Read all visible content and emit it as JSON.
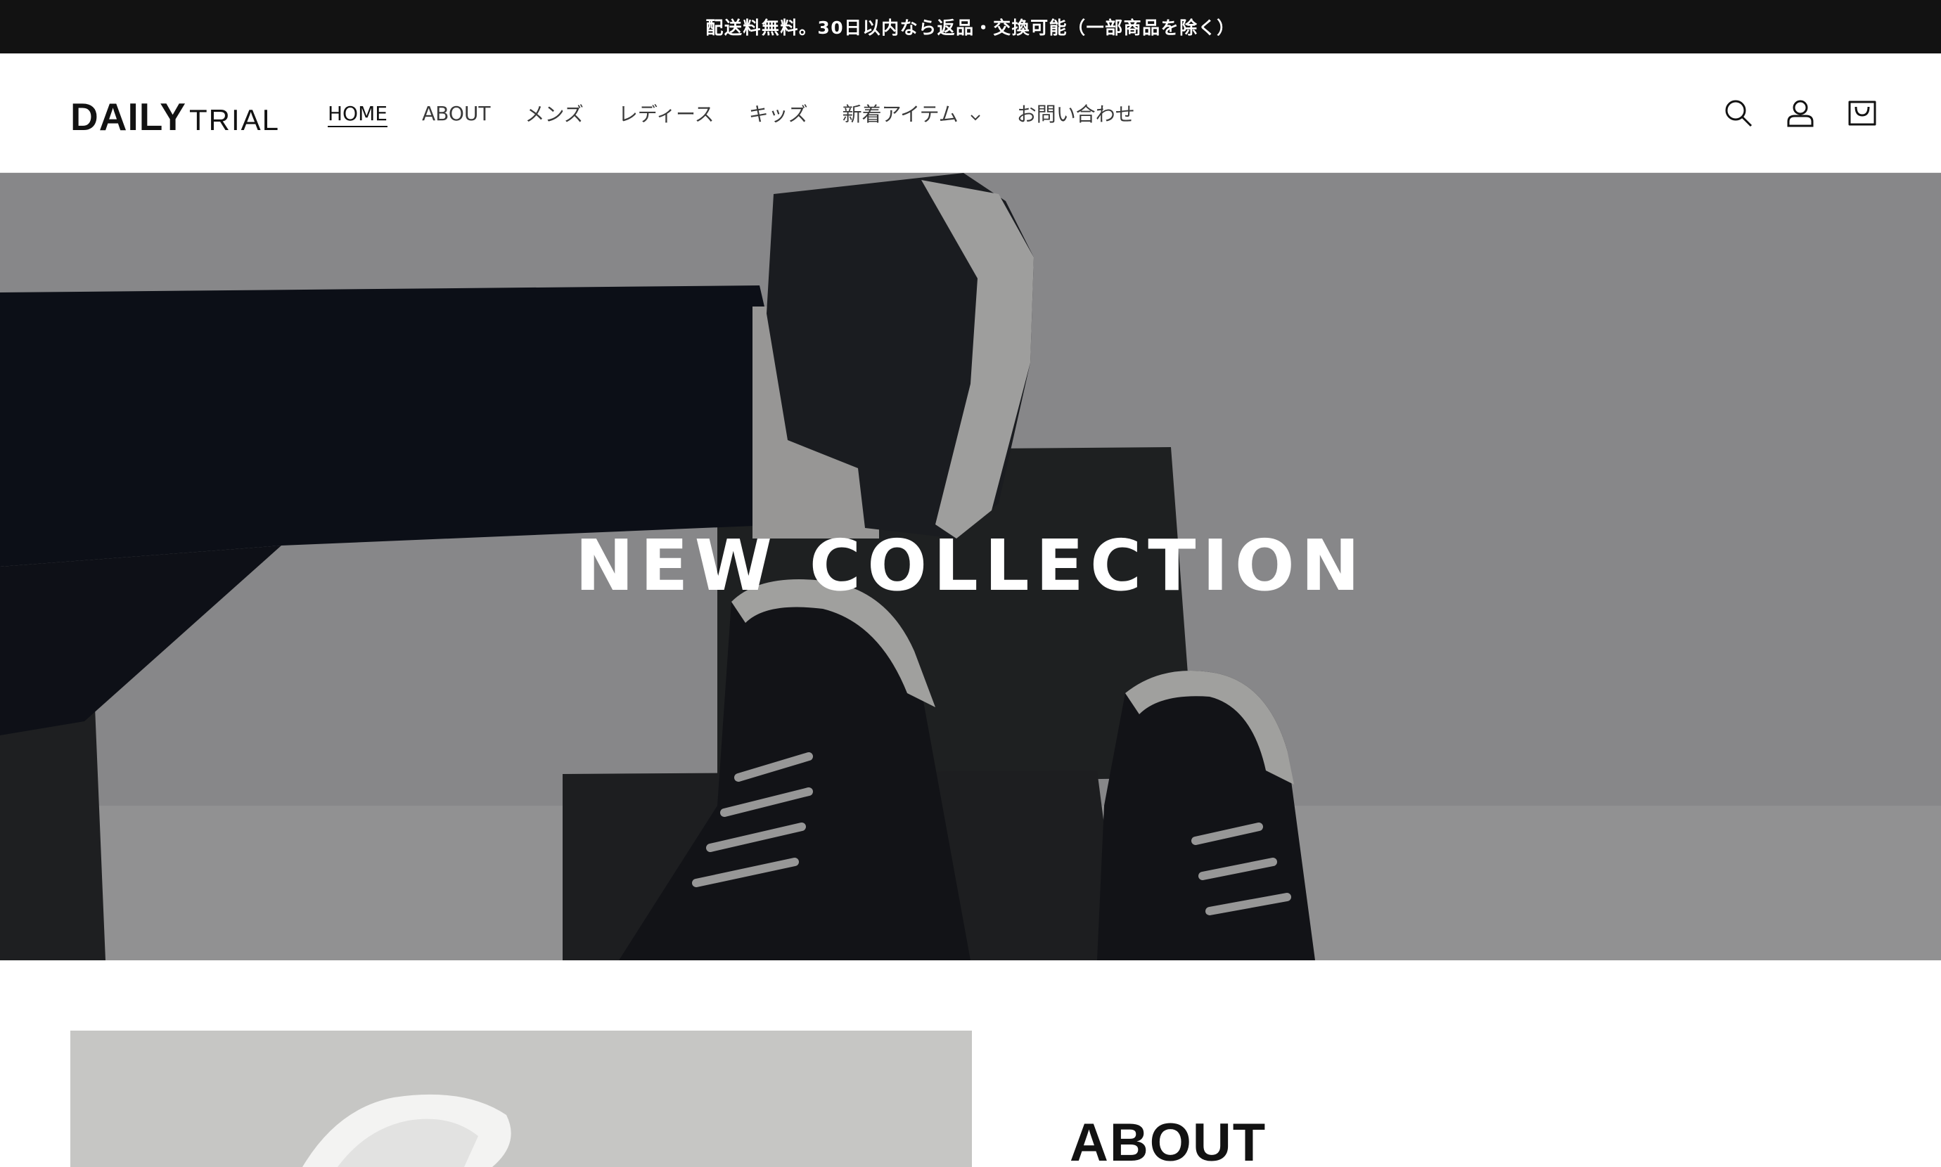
{
  "announcement": {
    "text": "配送料無料。30日以内なら返品・交換可能（一部商品を除く）"
  },
  "header": {
    "logo": {
      "part1": "DAILY",
      "part2": "TRIAL"
    },
    "nav": [
      {
        "label": "HOME",
        "active": true
      },
      {
        "label": "ABOUT"
      },
      {
        "label": "メンズ"
      },
      {
        "label": "レディース"
      },
      {
        "label": "キッズ"
      },
      {
        "label": "新着アイテム",
        "has_dropdown": true
      },
      {
        "label": "お問い合わせ"
      }
    ],
    "icons": [
      "search-icon",
      "account-icon",
      "cart-icon"
    ]
  },
  "hero": {
    "title": "NEW COLLECTION"
  },
  "about": {
    "heading": "ABOUT"
  },
  "colors": {
    "announcement_bg": "#121212",
    "text": "#121212",
    "nav_text": "#3a3a3a",
    "hero_overlay": "rgba(0,0,0,0.30)"
  }
}
